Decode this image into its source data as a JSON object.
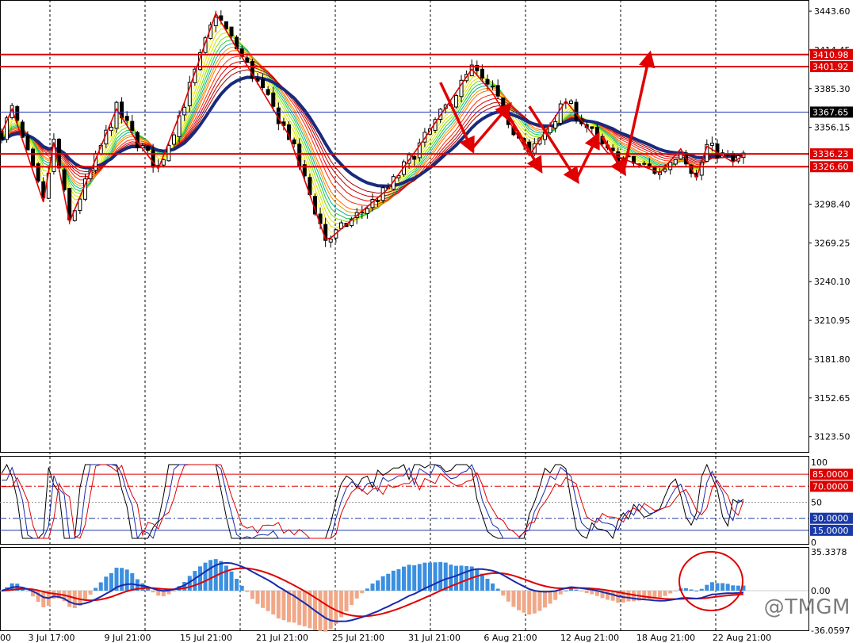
{
  "watermark": "@TMGM",
  "chart_data": [
    {
      "type": "candlestick",
      "panel": "main",
      "y_ticks": [
        "3443.60",
        "3414.45",
        "3385.30",
        "3356.15",
        "3298.40",
        "3269.25",
        "3240.10",
        "3210.95",
        "3181.80",
        "3152.65",
        "3123.50"
      ],
      "x_ticks": [
        "3 Jul 17:00",
        "9 Jul 21:00",
        "15 Jul 21:00",
        "21 Jul 21:00",
        "25 Jul 21:00",
        "31 Jul 21:00",
        "6 Aug 21:00",
        "12 Aug 21:00",
        "18 Aug 21:00",
        "22 Aug 21:00"
      ],
      "first_x_tick_fragment": "00",
      "ylim": [
        3112,
        3452
      ],
      "horizontal_levels": [
        {
          "label": "3410.98",
          "value": 3410.98,
          "color": "#dd0000"
        },
        {
          "label": "3401.92",
          "value": 3401.92,
          "color": "#dd0000"
        },
        {
          "label": "3367.65",
          "value": 3367.65,
          "color": "#2a3bb8"
        },
        {
          "label": "3336.23",
          "value": 3336.23,
          "color": "#dd0000"
        },
        {
          "label": "3326.60",
          "value": 3326.6,
          "color": "#dd0000"
        }
      ],
      "zigzag_pivots": [
        [
          0,
          3352
        ],
        [
          2,
          3370
        ],
        [
          8,
          3300
        ],
        [
          10,
          3345
        ],
        [
          13,
          3285
        ],
        [
          22,
          3370
        ],
        [
          26,
          3345
        ],
        [
          30,
          3325
        ],
        [
          35,
          3375
        ],
        [
          41,
          3442
        ],
        [
          55,
          3350
        ],
        [
          62,
          3272
        ],
        [
          63,
          3273
        ],
        [
          74,
          3310
        ],
        [
          81,
          3348
        ],
        [
          90,
          3400
        ],
        [
          94,
          3382
        ],
        [
          101,
          3335
        ],
        [
          108,
          3376
        ],
        [
          116,
          3337
        ],
        [
          126,
          3322
        ],
        [
          130,
          3340
        ],
        [
          133,
          3318
        ],
        [
          135,
          3342
        ],
        [
          140,
          3330
        ],
        [
          142,
          3335
        ]
      ],
      "annotation_arrows": [
        {
          "from": [
            84,
            3390
          ],
          "to": [
            90,
            3340
          ]
        },
        {
          "from": [
            90,
            3340
          ],
          "to": [
            97,
            3372
          ]
        },
        {
          "from": [
            96,
            3372
          ],
          "to": [
            103,
            3325
          ]
        },
        {
          "from": [
            101,
            3372
          ],
          "to": [
            110,
            3317
          ]
        },
        {
          "from": [
            110,
            3317
          ],
          "to": [
            114,
            3349
          ]
        },
        {
          "from": [
            115,
            3349
          ],
          "to": [
            119,
            3323
          ]
        },
        {
          "from": [
            119,
            3322
          ],
          "to": [
            124,
            3410
          ]
        }
      ],
      "ma_colors": [
        "#ffff00",
        "#e8d900",
        "#c8e800",
        "#7ee000",
        "#20c840",
        "#00b0a0",
        "#e89a00",
        "#ff6a00",
        "#ff2a00",
        "#e00000",
        "#c00000",
        "#a80000"
      ],
      "long_ma_color": "#1a2a7a"
    },
    {
      "type": "line",
      "panel": "oscillator",
      "ylim": [
        0,
        100
      ],
      "y_ticks": [
        "100",
        "50",
        "0"
      ],
      "levels": [
        {
          "label": "85.0000",
          "value": 85,
          "color": "#dd0000"
        },
        {
          "label": "70.0000",
          "value": 70,
          "color": "#dd0000"
        },
        {
          "label": "30.0000",
          "value": 30,
          "color": "#1a3aa8"
        },
        {
          "label": "15.0000",
          "value": 15,
          "color": "#1a3aa8"
        }
      ]
    },
    {
      "type": "bar",
      "panel": "macd",
      "ylim": [
        -36.0597,
        35.3378
      ],
      "y_ticks": [
        "35.3378",
        "0.00",
        "-36.0597"
      ],
      "colors": {
        "up": "#3a8fe0",
        "down": "#f0a888",
        "signal": "#e00000",
        "macd": "#1a2aaa"
      }
    }
  ]
}
